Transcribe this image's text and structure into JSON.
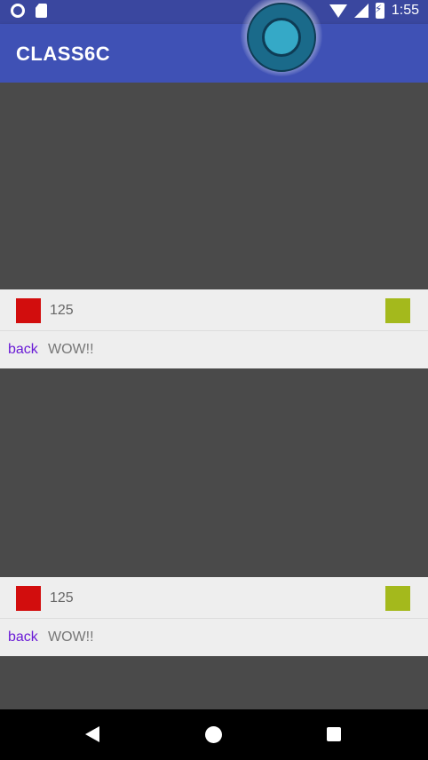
{
  "status_bar": {
    "time": "1:55"
  },
  "app_bar": {
    "title": "CLASS6C"
  },
  "cards": [
    {
      "count": "125",
      "back_label": "back",
      "message": "WOW!!"
    },
    {
      "count": "125",
      "back_label": "back",
      "message": "WOW!!"
    }
  ],
  "colors": {
    "app_bar": "#3f51b5",
    "status_bar": "#3a479f",
    "background": "#4a4a4a",
    "card": "#eeeeee",
    "red_square": "#d20d0d",
    "green_square": "#a4b91c",
    "link": "#6a1bd6"
  }
}
